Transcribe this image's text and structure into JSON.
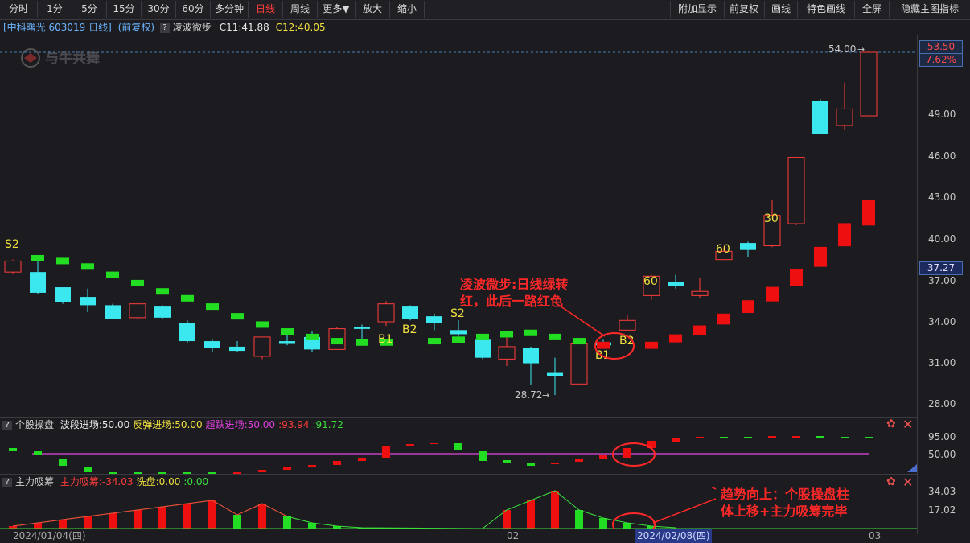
{
  "toolbar": {
    "left": [
      "分时",
      "1分",
      "5分",
      "15分",
      "30分",
      "60分",
      "多分钟",
      "日线",
      "周线",
      "更多▼",
      "放大",
      "缩小"
    ],
    "right": [
      "附加显示",
      "前复权",
      "画线",
      "特色画线",
      "全屏",
      "隐藏主图指标"
    ],
    "active": "日线"
  },
  "info": {
    "stock": "[中科曙光 603019 日线]",
    "adjust": "(前复权)",
    "indicator": "凌波微步",
    "c1": "C11:41.88",
    "c2": "C12:40.05"
  },
  "watermark": "与牛共舞",
  "price_axis": {
    "labels": [
      "53.50",
      "49.00",
      "46.00",
      "43.00",
      "40.00",
      "37.00",
      "34.00",
      "31.00",
      "28.00"
    ],
    "last_price": "53.50",
    "last_pct": "7.62%",
    "cursor_price": "37.27",
    "high_mark": "54.00",
    "low_mark": "28.72"
  },
  "signals": [
    "S2",
    "B1",
    "B2",
    "S2",
    "B1",
    "B2",
    "60",
    "60",
    "30"
  ],
  "panel1": {
    "title": "个股操盘",
    "items": [
      {
        "label": "波段进场:50.00",
        "color": "#e8e8e8"
      },
      {
        "label": "反弹进场:50.00",
        "color": "#f0e040"
      },
      {
        "label": "超跌进场:50.00",
        "color": "#e040e0"
      },
      {
        "label": ":93.94",
        "color": "#ff3b3b"
      },
      {
        "label": ":91.72",
        "color": "#3be03b"
      }
    ],
    "axis": [
      "95.00",
      "50.00"
    ]
  },
  "panel2": {
    "title": "主力吸筹",
    "items": [
      {
        "label": "主力吸筹:-34.03",
        "color": "#ff3b3b"
      },
      {
        "label": "洗盘:0.00",
        "color": "#f0e040"
      },
      {
        "label": ":0.00",
        "color": "#3be03b"
      }
    ],
    "axis": [
      "34.03",
      "17.02"
    ]
  },
  "dates": {
    "d1": "2024/01/04(四)",
    "d2": "02",
    "d3": "2024/02/08(四)",
    "d4": "03"
  },
  "annotations": {
    "a1_line1": "凌波微步:日线绿转",
    "a1_line2": "红，此后一路红色",
    "a2_line1": "趋势向上：个股操盘柱",
    "a2_line2": "体上移+主力吸筹完毕"
  }
}
